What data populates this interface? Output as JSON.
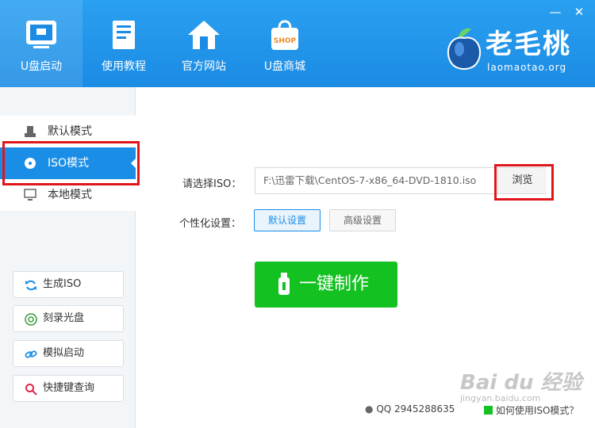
{
  "window": {
    "minimize": "—",
    "close": "✕"
  },
  "nav": [
    {
      "label": "U盘启动",
      "icon": "usb-drive-icon"
    },
    {
      "label": "使用教程",
      "icon": "book-icon"
    },
    {
      "label": "官方网站",
      "icon": "home-icon"
    },
    {
      "label": "U盘商城",
      "icon": "shop-bag-icon",
      "badge": "SHOP"
    }
  ],
  "logo": {
    "name": "老毛桃",
    "domain": "laomaotao.org"
  },
  "modes": [
    {
      "label": "默认模式",
      "icon": "usb-icon"
    },
    {
      "label": "ISO模式",
      "icon": "disc-icon",
      "selected": true
    },
    {
      "label": "本地模式",
      "icon": "monitor-icon"
    }
  ],
  "actions": [
    {
      "label": "生成ISO",
      "icon": "refresh-icon"
    },
    {
      "label": "刻录光盘",
      "icon": "burn-disc-icon"
    },
    {
      "label": "模拟启动",
      "icon": "link-icon"
    },
    {
      "label": "快捷键查询",
      "icon": "search-icon"
    }
  ],
  "main": {
    "iso_label": "请选择ISO：",
    "iso_path": "F:\\迅雷下载\\CentOS-7-x86_64-DVD-1810.iso",
    "browse": "浏览",
    "personal_label": "个性化设置：",
    "default_settings": "默认设置",
    "advanced_settings": "高级设置",
    "make_button": "一键制作"
  },
  "footer": {
    "qq": "QQ 2945288635",
    "help": "如何使用ISO模式？"
  },
  "watermark": {
    "text": "Bai du 经验",
    "sub": "jingyan.baidu.com"
  },
  "colors": {
    "accent": "#1a8ee6",
    "header": "#2aa0f0",
    "make": "#13c121",
    "highlight": "#e0161b"
  }
}
